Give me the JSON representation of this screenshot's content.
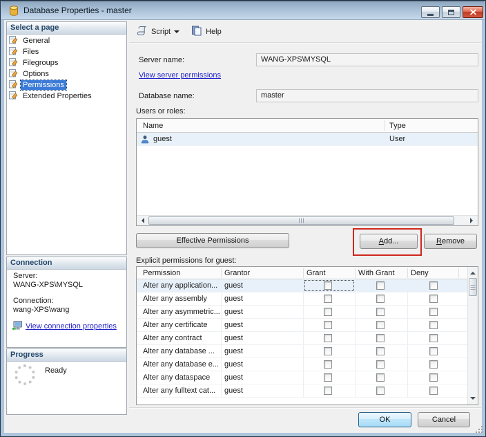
{
  "window": {
    "title": "Database Properties - master",
    "title_icon": "database-icon"
  },
  "sidebar": {
    "select_page": {
      "header": "Select a page",
      "items": [
        {
          "label": "General",
          "selected": false
        },
        {
          "label": "Files",
          "selected": false
        },
        {
          "label": "Filegroups",
          "selected": false
        },
        {
          "label": "Options",
          "selected": false
        },
        {
          "label": "Permissions",
          "selected": true
        },
        {
          "label": "Extended Properties",
          "selected": false
        }
      ]
    },
    "connection": {
      "header": "Connection",
      "server_label": "Server:",
      "server_value": "WANG-XPS\\MYSQL",
      "connection_label": "Connection:",
      "connection_value": "wang-XPS\\wang",
      "view_link": "View connection properties"
    },
    "progress": {
      "header": "Progress",
      "status": "Ready"
    }
  },
  "toolbar": {
    "script_label": "Script",
    "help_label": "Help"
  },
  "main": {
    "server_name_label": "Server name:",
    "server_name_value": "WANG-XPS\\MYSQL",
    "view_server_permissions_link": "View server permissions",
    "database_name_label": "Database name:",
    "database_name_value": "master",
    "users_or_roles_label": "Users or roles:",
    "users_table": {
      "columns": [
        "Name",
        "Type"
      ],
      "rows": [
        {
          "name": "guest",
          "type": "User",
          "icon": "user-icon"
        }
      ]
    },
    "effective_permissions_button": "Effective Permissions",
    "add_button": "Add...",
    "remove_button": "Remove",
    "explicit_permissions_label": "Explicit permissions for guest:",
    "permissions_table": {
      "columns": [
        "Permission",
        "Grantor",
        "Grant",
        "With Grant",
        "Deny"
      ],
      "rows": [
        {
          "permission": "Alter any application...",
          "grantor": "guest",
          "grant": false,
          "with_grant": false,
          "deny": false,
          "selected": true
        },
        {
          "permission": "Alter any assembly",
          "grantor": "guest",
          "grant": false,
          "with_grant": false,
          "deny": false,
          "selected": false
        },
        {
          "permission": "Alter any asymmetric...",
          "grantor": "guest",
          "grant": false,
          "with_grant": false,
          "deny": false,
          "selected": false
        },
        {
          "permission": "Alter any certificate",
          "grantor": "guest",
          "grant": false,
          "with_grant": false,
          "deny": false,
          "selected": false
        },
        {
          "permission": "Alter any contract",
          "grantor": "guest",
          "grant": false,
          "with_grant": false,
          "deny": false,
          "selected": false
        },
        {
          "permission": "Alter any database ...",
          "grantor": "guest",
          "grant": false,
          "with_grant": false,
          "deny": false,
          "selected": false
        },
        {
          "permission": "Alter any database e...",
          "grantor": "guest",
          "grant": false,
          "with_grant": false,
          "deny": false,
          "selected": false
        },
        {
          "permission": "Alter any dataspace",
          "grantor": "guest",
          "grant": false,
          "with_grant": false,
          "deny": false,
          "selected": false
        },
        {
          "permission": "Alter any fulltext cat...",
          "grantor": "guest",
          "grant": false,
          "with_grant": false,
          "deny": false,
          "selected": false
        }
      ]
    },
    "annotation": {
      "type": "highlight-box",
      "target": "add-button",
      "color": "#d0261d"
    }
  },
  "footer": {
    "ok_button": "OK",
    "cancel_button": "Cancel"
  },
  "icons": [
    "database-icon",
    "page-edit-icon",
    "script-scroll-icon",
    "help-book-icon",
    "user-icon",
    "connection-properties-icon",
    "progress-spinner-icon"
  ],
  "colors": {
    "selection_blue": "#3b7bd8",
    "link_blue": "#2222cc",
    "annotation_red": "#d0261d",
    "dialog_bg": "#f0f0f0",
    "row_highlight": "#e8f1fa",
    "titlebar_top": "#8ea7bf",
    "titlebar_bottom": "#c6d9ec"
  }
}
